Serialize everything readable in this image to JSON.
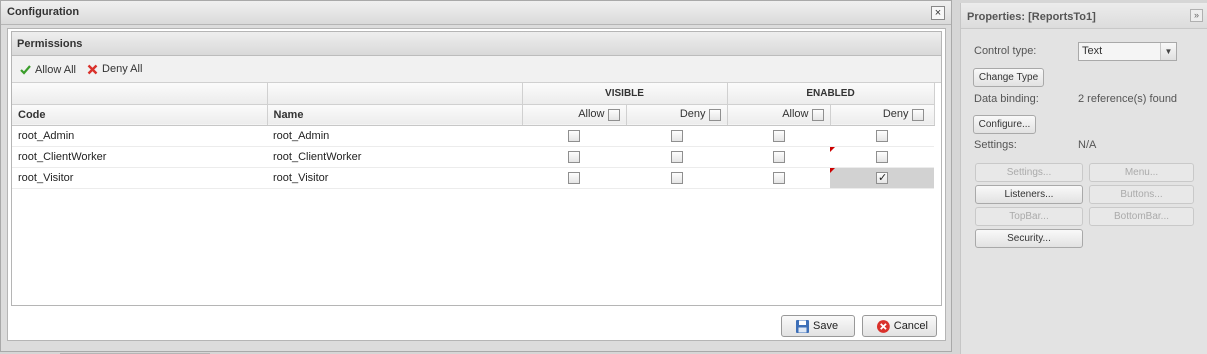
{
  "dialog": {
    "title": "Configuration",
    "close_label": "×",
    "panel_title": "Permissions",
    "toolbar": {
      "allow_all": "Allow All",
      "deny_all": "Deny All"
    },
    "group_headers": {
      "visible": "VISIBLE",
      "enabled": "ENABLED"
    },
    "columns": {
      "code": "Code",
      "name": "Name",
      "allow": "Allow",
      "deny": "Deny"
    },
    "rows": [
      {
        "code": "root_Admin",
        "name": "root_Admin",
        "visible_allow": false,
        "visible_deny": false,
        "enabled_allow": false,
        "enabled_deny": false
      },
      {
        "code": "root_ClientWorker",
        "name": "root_ClientWorker",
        "visible_allow": false,
        "visible_deny": false,
        "enabled_allow": false,
        "enabled_deny": false
      },
      {
        "code": "root_Visitor",
        "name": "root_Visitor",
        "visible_allow": false,
        "visible_deny": false,
        "enabled_allow": false,
        "enabled_deny": true
      }
    ],
    "buttons": {
      "save": "Save",
      "cancel": "Cancel"
    }
  },
  "properties": {
    "title": "Properties: [ReportsTo1]",
    "collapse_label": "»",
    "control_type_label": "Control type:",
    "control_type_value": "Text",
    "change_type_button": "Change Type",
    "data_binding_label": "Data binding:",
    "data_binding_value": "2 reference(s) found",
    "configure_button": "Configure...",
    "settings_label": "Settings:",
    "settings_value": "N/A",
    "buttons": {
      "settings": "Settings...",
      "menu": "Menu...",
      "listeners": "Listeners...",
      "buttons": "Buttons...",
      "topbar": "TopBar...",
      "bottombar": "BottomBar...",
      "security": "Security..."
    }
  },
  "icons": {
    "allow_all": "checkmark-icon",
    "deny_all": "x-icon",
    "save": "floppy-disk-icon",
    "cancel": "cancel-circle-icon"
  },
  "colors": {
    "check_green": "#3a9d2a",
    "deny_red": "#d9312b",
    "dirty_marker": "#cc0000"
  }
}
